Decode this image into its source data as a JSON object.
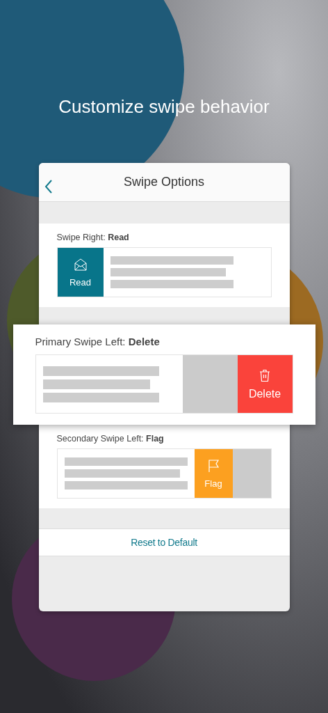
{
  "headline": "Customize swipe behavior",
  "screen": {
    "title": "Swipe Options",
    "sections": [
      {
        "label": "Swipe Right: **Read**",
        "highlighted": false,
        "kind": "leading",
        "action": {
          "kind": "read",
          "label": "Read",
          "color": "#08758a"
        }
      },
      {
        "label": "Primary Swipe Left: **Delete**",
        "highlighted": true,
        "kind": "trailing",
        "action": {
          "kind": "delete",
          "label": "Delete",
          "color": "#fa433b"
        }
      },
      {
        "label": "Secondary Swipe Left: **Flag**",
        "highlighted": false,
        "kind": "secondary",
        "action": {
          "kind": "flag",
          "label": "Flag",
          "color": "#fca020"
        }
      }
    ],
    "reset_button": "Reset to Default"
  }
}
